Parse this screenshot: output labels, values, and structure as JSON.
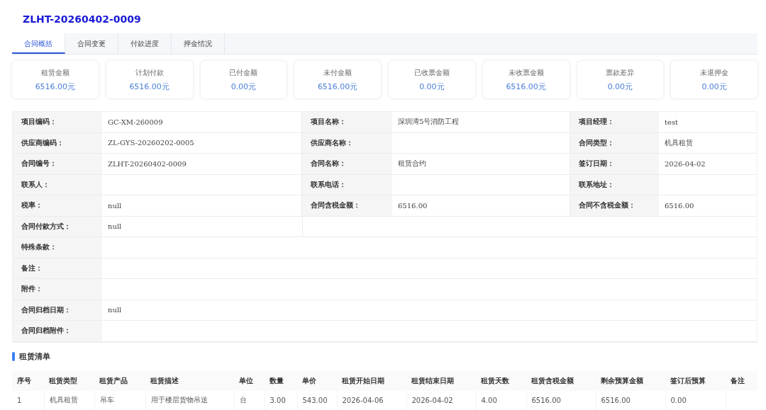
{
  "title": "ZLHT-20260402-0009",
  "tabs": [
    {
      "label": "合同概括",
      "selected": true
    },
    {
      "label": "合同变更",
      "selected": false
    },
    {
      "label": "付款进度",
      "selected": false
    },
    {
      "label": "押金情况",
      "selected": false
    }
  ],
  "summary_cards": [
    {
      "label": "租赁金额",
      "value": "6516.00元"
    },
    {
      "label": "计划付款",
      "value": "6516.00元"
    },
    {
      "label": "已付金额",
      "value": "0.00元"
    },
    {
      "label": "未付金额",
      "value": "6516.00元"
    },
    {
      "label": "已收票金额",
      "value": "0.00元"
    },
    {
      "label": "未收票金额",
      "value": "6516.00元"
    },
    {
      "label": "票款差异",
      "value": "0.00元"
    },
    {
      "label": "未退押金",
      "value": "0.00元"
    }
  ],
  "details": [
    {
      "kind": "triple",
      "fields": [
        {
          "label": "项目编码：",
          "value": "GC-XM-260009"
        },
        {
          "label": "项目名称：",
          "value": "深圳湾5号消防工程"
        },
        {
          "label": "项目经理：",
          "value": "test"
        }
      ]
    },
    {
      "kind": "triple",
      "fields": [
        {
          "label": "供应商编码：",
          "value": "ZL-GYS-20260202-0005"
        },
        {
          "label": "供应商名称："
        },
        {
          "label": "合同类型：",
          "value": "机具租赁"
        }
      ]
    },
    {
      "kind": "triple",
      "fields": [
        {
          "label": "合同编号：",
          "value": "ZLHT-20260402-0009"
        },
        {
          "label": "合同名称：",
          "value": "租赁合约"
        },
        {
          "label": "签订日期：",
          "value": "2026-04-02"
        }
      ]
    },
    {
      "kind": "triple",
      "fields": [
        {
          "label": "联系人："
        },
        {
          "label": "联系电话："
        },
        {
          "label": "联系地址："
        }
      ]
    },
    {
      "kind": "triple",
      "fields": [
        {
          "label": "税率：",
          "value": "null"
        },
        {
          "label": "合同含税金额：",
          "value": "6516.00"
        },
        {
          "label": "合同不含税金额：",
          "value": "6516.00"
        }
      ]
    },
    {
      "kind": "single",
      "fields": [
        {
          "label": "合同付款方式：",
          "value": "null"
        }
      ]
    },
    {
      "kind": "full",
      "fields": [
        {
          "label": "特殊条款："
        }
      ]
    },
    {
      "kind": "full",
      "fields": [
        {
          "label": "备注："
        }
      ]
    },
    {
      "kind": "full",
      "fields": [
        {
          "label": "附件："
        }
      ]
    },
    {
      "kind": "full",
      "fields": [
        {
          "label": "合同归档日期：",
          "value": "null"
        }
      ]
    },
    {
      "kind": "full",
      "fields": [
        {
          "label": "合同归档附件："
        }
      ]
    }
  ],
  "rental_list": {
    "title": "租赁清单",
    "columns": [
      "序号",
      "租赁类型",
      "租赁产品",
      "租赁描述",
      "单位",
      "数量",
      "单价",
      "租赁开始日期",
      "租赁结束日期",
      "租赁天数",
      "租赁含税金额",
      "剩余预算金额",
      "签订后预算",
      "备注"
    ],
    "rows": [
      [
        "1",
        "机具租赁",
        "吊车",
        "用于楼层货物吊送",
        "台",
        "3.00",
        "543.00",
        "2026-04-06",
        "2026-04-02",
        "4.00",
        "6516.00",
        "6516.00",
        "0.00",
        ""
      ]
    ]
  }
}
